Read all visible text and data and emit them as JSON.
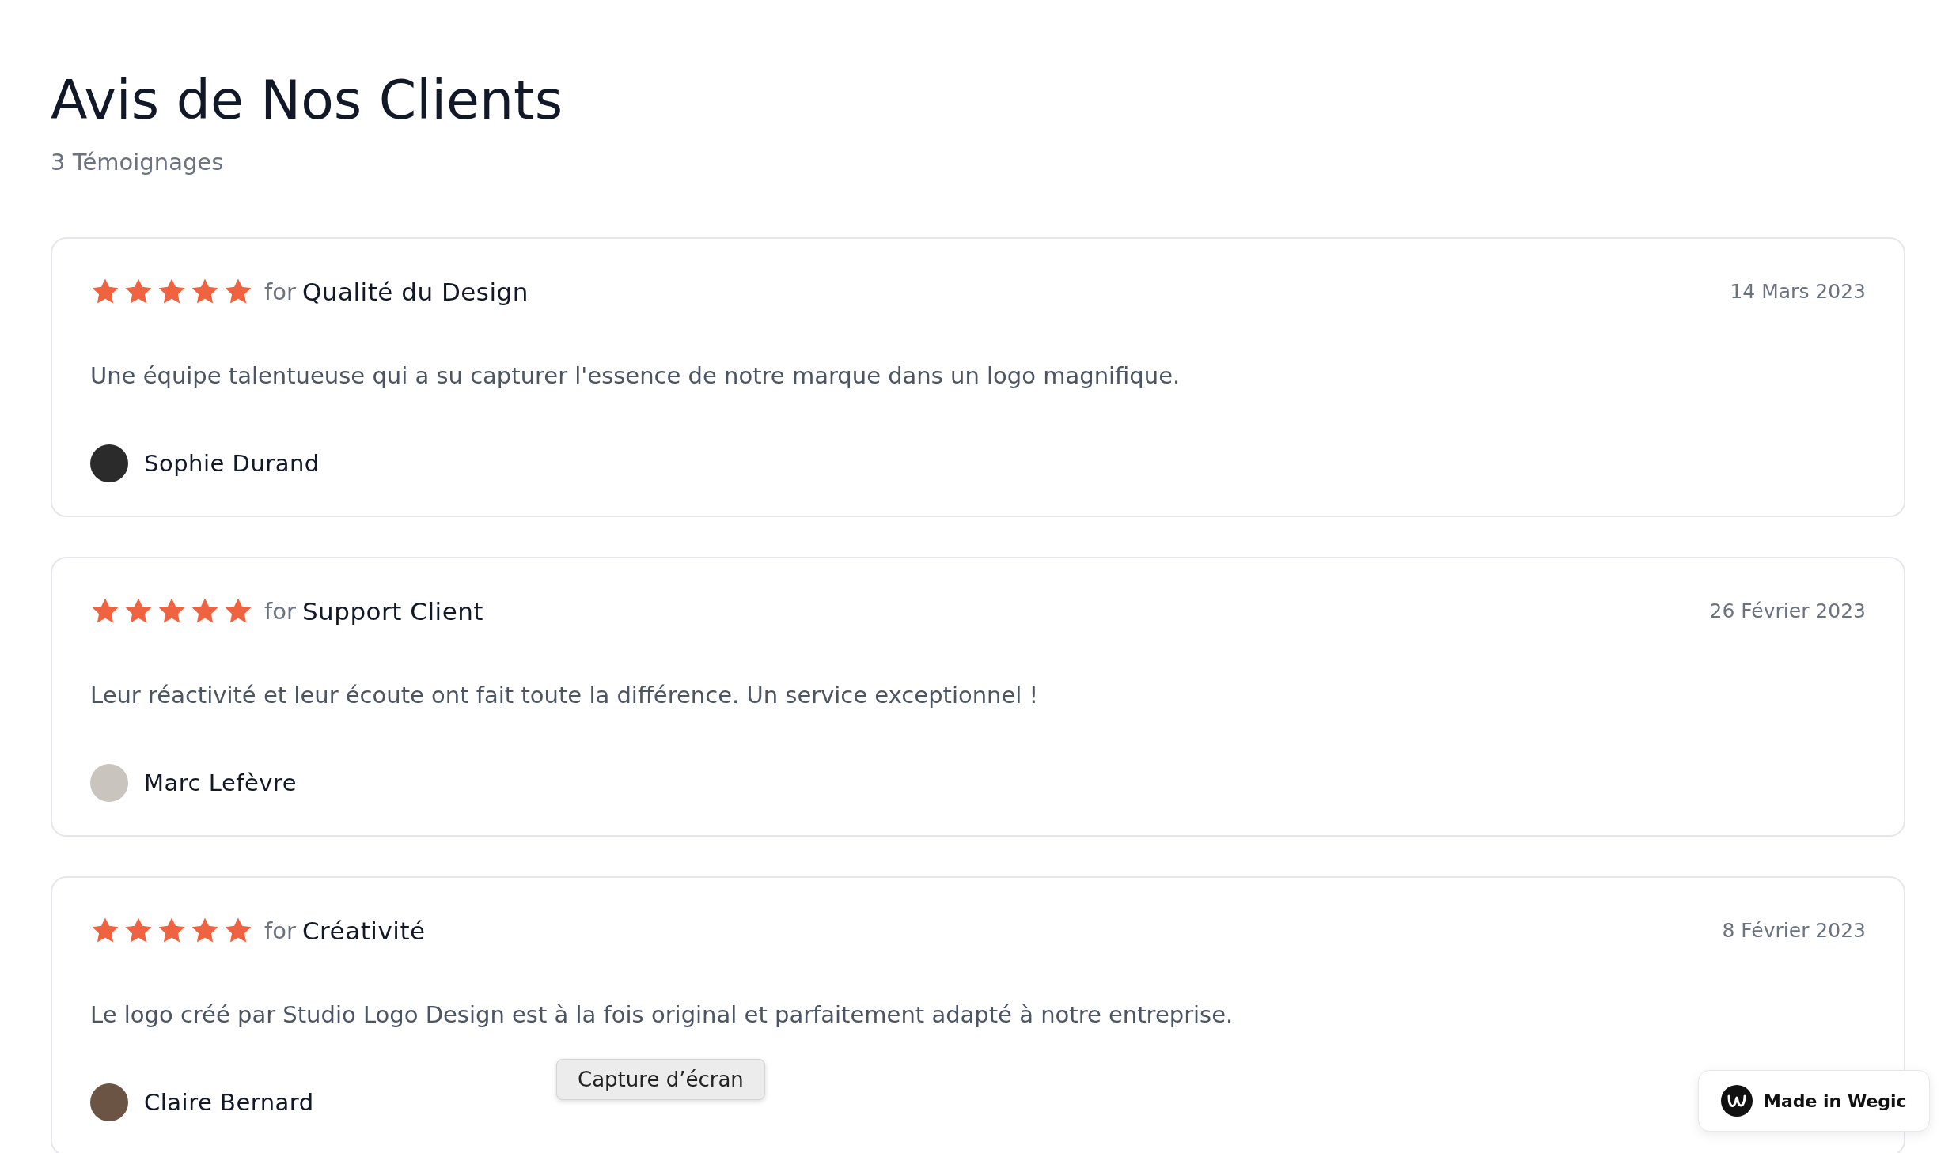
{
  "header": {
    "title": "Avis de Nos Clients",
    "count": "3 Témoignages"
  },
  "reviews": [
    {
      "stars": 5,
      "for_label": "for",
      "topic": "Qualité du Design",
      "date": "14 Mars 2023",
      "quote": "Une équipe talentueuse qui a su capturer l'essence de notre marque dans un logo magnifique.",
      "author": "Sophie Durand"
    },
    {
      "stars": 5,
      "for_label": "for",
      "topic": "Support Client",
      "date": "26 Février 2023",
      "quote": "Leur réactivité et leur écoute ont fait toute la différence. Un service exceptionnel !",
      "author": "Marc Lefèvre"
    },
    {
      "stars": 5,
      "for_label": "for",
      "topic": "Créativité",
      "date": "8 Février 2023",
      "quote": "Le logo créé par Studio Logo Design est à la fois original et parfaitement adapté à notre entreprise.",
      "author": "Claire Bernard"
    }
  ],
  "tooltip": "Capture d’écran",
  "badge": {
    "label": "Made in Wegic"
  }
}
